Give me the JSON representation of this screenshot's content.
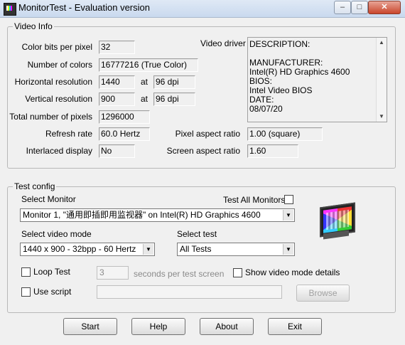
{
  "window": {
    "title": "MonitorTest - Evaluation version",
    "min": "–",
    "max": "□",
    "close": "✕"
  },
  "video_info": {
    "legend": "Video Info",
    "color_bits_label": "Color bits per pixel",
    "color_bits": "32",
    "num_colors_label": "Number of colors",
    "num_colors": "16777216 (True Color)",
    "h_res_label": "Horizontal resolution",
    "h_res": "1440",
    "h_at": "at",
    "h_dpi": "96 dpi",
    "v_res_label": "Vertical resolution",
    "v_res": "900",
    "v_at": "at",
    "v_dpi": "96 dpi",
    "total_pixels_label": "Total number of pixels",
    "total_pixels": "1296000",
    "refresh_label": "Refresh rate",
    "refresh": "60.0 Hertz",
    "interlaced_label": "Interlaced display",
    "interlaced": "No",
    "driver_label": "Video driver",
    "driver_lines": [
      "DESCRIPTION:",
      "",
      "MANUFACTURER:",
      "Intel(R) HD Graphics 4600",
      "BIOS:",
      "Intel Video BIOS",
      "DATE:",
      "08/07/20"
    ],
    "pixel_aspect_label": "Pixel aspect ratio",
    "pixel_aspect": "1.00 (square)",
    "screen_aspect_label": "Screen aspect ratio",
    "screen_aspect": "1.60"
  },
  "test_config": {
    "legend": "Test config",
    "select_monitor_label": "Select Monitor",
    "monitor_value": "Monitor 1, \"通用即插即用监视器\" on Intel(R) HD Graphics 4600",
    "test_all_label": "Test All Monitors",
    "select_mode_label": "Select video mode",
    "mode_value": "1440 x 900 - 32bpp - 60 Hertz",
    "select_test_label": "Select test",
    "test_value": "All Tests",
    "loop_test_label": "Loop Test",
    "seconds_value": "3",
    "seconds_label": "seconds per test screen",
    "show_details_label": "Show video mode details",
    "use_script_label": "Use script",
    "browse_label": "Browse"
  },
  "buttons": {
    "start": "Start",
    "help": "Help",
    "about": "About",
    "exit": "Exit"
  }
}
